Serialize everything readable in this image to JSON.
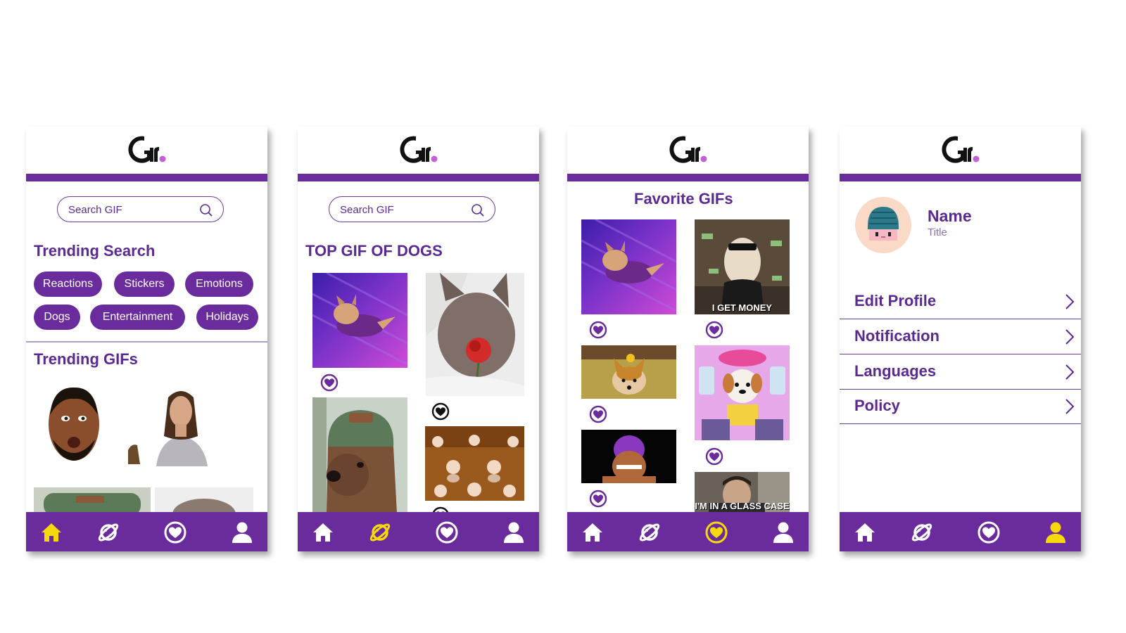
{
  "app": {
    "logo_text": "Gif"
  },
  "colors": {
    "brand_purple": "#6a2c9c",
    "text_purple": "#5a2a91",
    "active_yellow": "#f5d90a",
    "icon_white": "#ffffff",
    "logo_dot": "#c260d4"
  },
  "nav": {
    "items": [
      {
        "name": "home",
        "icon": "home-icon"
      },
      {
        "name": "discover",
        "icon": "planet-icon"
      },
      {
        "name": "favorites",
        "icon": "heart-icon"
      },
      {
        "name": "profile",
        "icon": "user-icon"
      }
    ]
  },
  "screens": {
    "home": {
      "active_tab": "home",
      "search_placeholder": "Search GIF",
      "trending_search_title": "Trending Search",
      "tags": [
        "Reactions",
        "Stickers",
        "Emotions",
        "Dogs",
        "Entertainment",
        "Holidays"
      ],
      "trending_gifs_title": "Trending GIFs"
    },
    "search": {
      "active_tab": "discover",
      "search_placeholder": "Search GIF",
      "title": "TOP GIF OF DOGS"
    },
    "favorites": {
      "active_tab": "favorites",
      "title": "Favorite GIFs",
      "captions": {
        "money": "I GET MONEY",
        "glass_case": "I'M IN A GLASS CASE"
      }
    },
    "profile": {
      "active_tab": "profile",
      "name": "Name",
      "title": "Title",
      "menu": [
        "Edit Profile",
        "Notification",
        "Languages",
        "Policy"
      ]
    }
  }
}
